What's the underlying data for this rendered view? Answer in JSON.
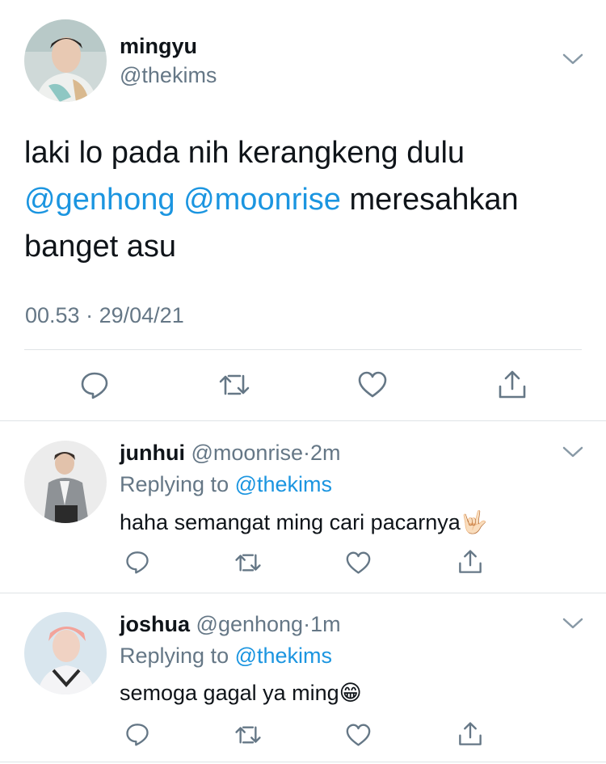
{
  "main_tweet": {
    "display_name": "mingyu",
    "handle": "@thekims",
    "text_line1": "laki lo pada nih kerangkeng dulu",
    "mention1": "@genhong",
    "mention2": "@moonrise",
    "text_line2_rest": "meresahkan",
    "text_line3": "banget asu",
    "time": "00.53",
    "separator": "·",
    "date": "29/04/21"
  },
  "replies": [
    {
      "display_name": "junhui",
      "handle": "@moonrise",
      "separator": "·",
      "age": "2m",
      "replying_prefix": "Replying to",
      "replying_to": "@thekims",
      "text": "haha semangat ming cari pacarnya",
      "emoji": "🤟🏻"
    },
    {
      "display_name": "joshua",
      "handle": "@genhong",
      "separator": "·",
      "age": "1m",
      "replying_prefix": "Replying to",
      "replying_to": "@thekims",
      "text": "semoga gagal ya ming",
      "emoji": "😁"
    }
  ],
  "icons": [
    "reply-icon",
    "retweet-icon",
    "like-icon",
    "share-icon",
    "chevron-down-icon"
  ],
  "colors": {
    "link": "#1b95e0",
    "muted": "#657786",
    "text": "#0f1419",
    "divider": "#dfe3e6"
  }
}
